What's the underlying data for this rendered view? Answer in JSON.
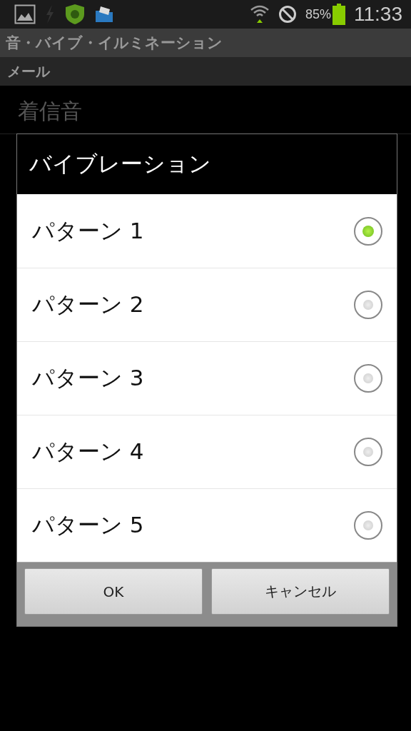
{
  "status_bar": {
    "battery": "85%",
    "time": "11:33"
  },
  "app_bar": {
    "title": "音・バイブ・イルミネーション"
  },
  "section_header": "メール",
  "settings": [
    {
      "title": "着信音"
    }
  ],
  "dialog": {
    "title": "バイブレーション",
    "options": [
      {
        "label": "パターン 1",
        "selected": true
      },
      {
        "label": "パターン 2",
        "selected": false
      },
      {
        "label": "パターン 3",
        "selected": false
      },
      {
        "label": "パターン 4",
        "selected": false
      },
      {
        "label": "パターン 5",
        "selected": false
      }
    ],
    "buttons": [
      "OK",
      "キャンセル"
    ]
  }
}
